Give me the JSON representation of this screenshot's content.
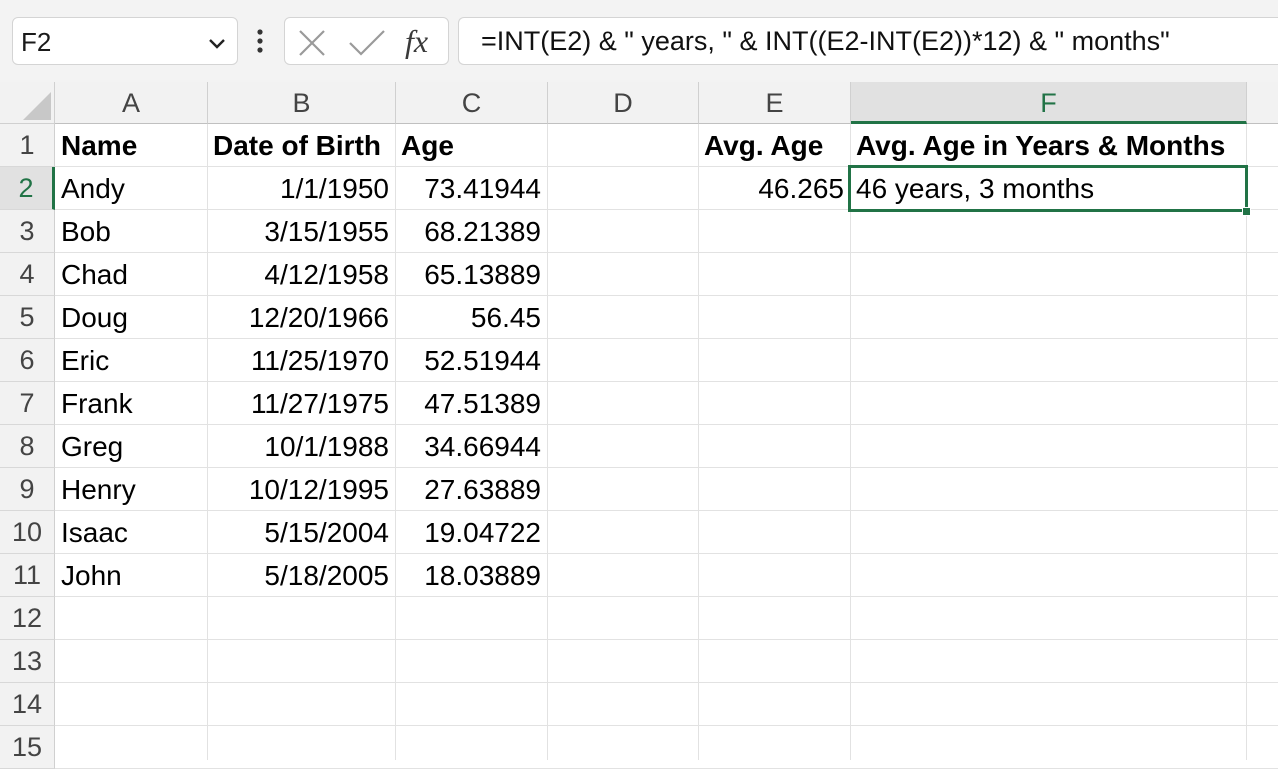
{
  "formula_bar": {
    "name_box": "F2",
    "formula": "=INT(E2) & \" years, \" & INT((E2-INT(E2))*12) & \" months\""
  },
  "columns": [
    "A",
    "B",
    "C",
    "D",
    "E",
    "F"
  ],
  "active_column": "F",
  "rows": [
    "1",
    "2",
    "3",
    "4",
    "5",
    "6",
    "7",
    "8",
    "9",
    "10",
    "11",
    "12",
    "13",
    "14",
    "15"
  ],
  "active_row": "2",
  "headers": {
    "name": "Name",
    "dob": "Date of Birth",
    "age": "Age",
    "avg_age": "Avg. Age",
    "avg_age_ym": "Avg. Age in Years & Months"
  },
  "table": [
    {
      "name": "Andy",
      "dob": "1/1/1950",
      "age": "73.41944"
    },
    {
      "name": "Bob",
      "dob": "3/15/1955",
      "age": "68.21389"
    },
    {
      "name": "Chad",
      "dob": "4/12/1958",
      "age": "65.13889"
    },
    {
      "name": "Doug",
      "dob": "12/20/1966",
      "age": "56.45"
    },
    {
      "name": "Eric",
      "dob": "11/25/1970",
      "age": "52.51944"
    },
    {
      "name": "Frank",
      "dob": "11/27/1975",
      "age": "47.51389"
    },
    {
      "name": "Greg",
      "dob": "10/1/1988",
      "age": "34.66944"
    },
    {
      "name": "Henry",
      "dob": "10/12/1995",
      "age": "27.63889"
    },
    {
      "name": "Isaac",
      "dob": "5/15/2004",
      "age": "19.04722"
    },
    {
      "name": "John",
      "dob": "5/18/2005",
      "age": "18.03889"
    }
  ],
  "summary": {
    "avg_age": "46.265",
    "avg_age_ym": "46 years, 3 months"
  },
  "colors": {
    "accent": "#217346",
    "header_bg": "#f2f2f2",
    "gridline": "#e2e2e2"
  }
}
